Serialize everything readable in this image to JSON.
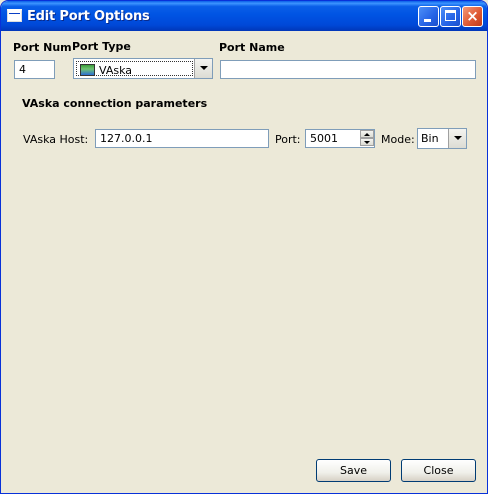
{
  "window": {
    "title": "Edit Port Options",
    "icon": "window-icon",
    "controls": {
      "minimize": "minimize-icon",
      "maximize": "maximize-icon",
      "close": "×"
    }
  },
  "fields": {
    "port_num_label": "Port Num",
    "port_num_value": "4",
    "port_type_label": "Port Type",
    "port_type_value": "VAska",
    "port_name_label": "Port Name",
    "port_name_value": ""
  },
  "section": {
    "heading": "VAska connection parameters",
    "host_label": "VAska Host:",
    "host_value": "127.0.0.1",
    "port_label": "Port:",
    "port_value": "5001",
    "mode_label": "Mode:",
    "mode_value": "Bin"
  },
  "buttons": {
    "save": "Save",
    "close": "Close"
  },
  "colors": {
    "titlebar": "#0054e3",
    "window_bg": "#ece9d8",
    "input_border": "#7f9db9",
    "button_border": "#003c74"
  }
}
